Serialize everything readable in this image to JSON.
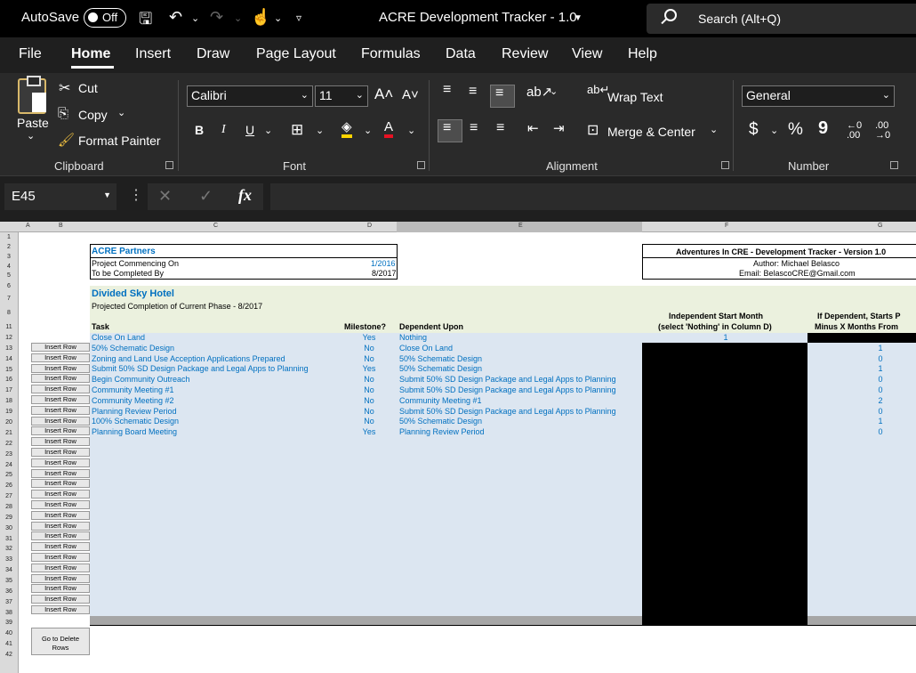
{
  "titlebar": {
    "autosave_label": "AutoSave",
    "autosave_state": "Off",
    "doc_title": "ACRE Development Tracker - 1.0",
    "search_placeholder": "Search (Alt+Q)"
  },
  "menu": [
    "File",
    "Home",
    "Insert",
    "Draw",
    "Page Layout",
    "Formulas",
    "Data",
    "Review",
    "View",
    "Help"
  ],
  "ribbon": {
    "clipboard": {
      "paste": "Paste",
      "cut": "Cut",
      "copy": "Copy",
      "format_painter": "Format Painter",
      "label": "Clipboard"
    },
    "font": {
      "name": "Calibri",
      "size": "11",
      "bold": "B",
      "italic": "I",
      "underline": "U",
      "label": "Font"
    },
    "alignment": {
      "wrap": "Wrap Text",
      "merge": "Merge & Center",
      "label": "Alignment"
    },
    "number": {
      "format": "General",
      "currency": "$",
      "percent": "%",
      "comma": "9",
      "label": "Number"
    }
  },
  "formula_bar": {
    "cell_ref": "E45",
    "fx": "fx",
    "content": ""
  },
  "columns": [
    "A",
    "B",
    "C",
    "D",
    "E",
    "F",
    "G"
  ],
  "rows": [
    "1",
    "2",
    "3",
    "4",
    "5",
    "6",
    "7",
    "8",
    "11",
    "12",
    "13",
    "14",
    "15",
    "16",
    "17",
    "18",
    "19",
    "20",
    "21",
    "22",
    "23",
    "24",
    "25",
    "26",
    "27",
    "28",
    "29",
    "30",
    "31",
    "32",
    "33",
    "34",
    "35",
    "36",
    "37",
    "38",
    "39",
    "40",
    "41",
    "42"
  ],
  "sheet": {
    "company": "ACRE Partners",
    "commencing_label": "Project Commencing On",
    "commencing_value": "1/2016",
    "completed_label": "To be Completed By",
    "completed_value": "8/2017",
    "info_title": "Adventures In CRE - Development Tracker - Version 1.0",
    "author": "Author: Michael Belasco",
    "email": "Email: BelascoCRE@Gmail.com",
    "project": "Divided Sky Hotel",
    "phase": "Projected Completion of Current Phase - 8/2017",
    "hdr_task": "Task",
    "hdr_milestone": "Milestone?",
    "hdr_dependent": "Dependent Upon",
    "hdr_start_1": "Independent Start Month",
    "hdr_start_2": "(select 'Nothing' in Column D)",
    "hdr_g_1": "If Dependent, Starts P",
    "hdr_g_2": "Minus X Months From",
    "insert_row": "Insert Row",
    "go_delete_1": "Go to Delete",
    "go_delete_2": "Rows",
    "tasks": [
      {
        "task": "Close On Land",
        "milestone": "Yes",
        "dep": "Nothing",
        "start": "1",
        "offset": ""
      },
      {
        "task": "50% Schematic Design",
        "milestone": "No",
        "dep": "Close On Land",
        "start": "",
        "offset": "1"
      },
      {
        "task": "Zoning and Land Use Acception Applications Prepared",
        "milestone": "No",
        "dep": "50% Schematic Design",
        "start": "",
        "offset": "0"
      },
      {
        "task": "Submit 50% SD Design Package and Legal Apps to Planning",
        "milestone": "Yes",
        "dep": "50% Schematic Design",
        "start": "",
        "offset": "1"
      },
      {
        "task": "Begin Community Outreach",
        "milestone": "No",
        "dep": "Submit 50% SD Design Package and Legal Apps to Planning",
        "start": "",
        "offset": "0"
      },
      {
        "task": "Community Meeting #1",
        "milestone": "No",
        "dep": "Submit 50% SD Design Package and Legal Apps to Planning",
        "start": "",
        "offset": "0"
      },
      {
        "task": "Community Meeting #2",
        "milestone": "No",
        "dep": "Community Meeting #1",
        "start": "",
        "offset": "2"
      },
      {
        "task": "Planning Review Period",
        "milestone": "No",
        "dep": "Submit 50% SD Design Package and Legal Apps to Planning",
        "start": "",
        "offset": "0"
      },
      {
        "task": "100% Schematic Design",
        "milestone": "No",
        "dep": "50% Schematic Design",
        "start": "",
        "offset": "1"
      },
      {
        "task": "Planning Board Meeting",
        "milestone": "Yes",
        "dep": "Planning Review Period",
        "start": "",
        "offset": "0"
      }
    ]
  }
}
